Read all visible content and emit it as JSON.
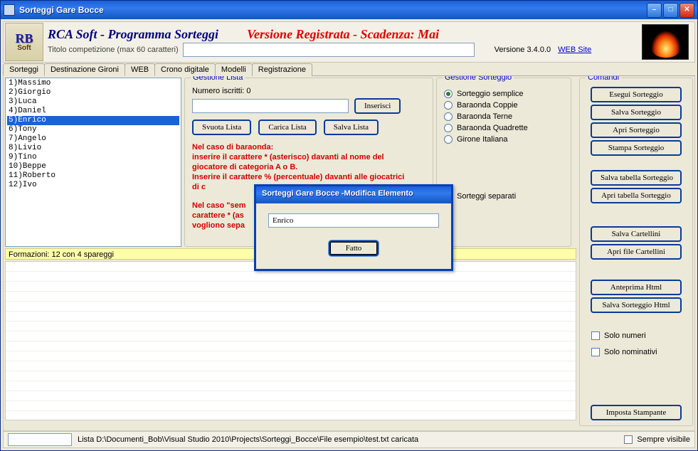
{
  "window": {
    "title": "Sorteggi Gare Bocce"
  },
  "header": {
    "app_title": "RCA Soft - Programma Sorteggi",
    "registered": "Versione Registrata - Scadenza: Mai",
    "comp_label": "Titolo competizione (max 60 caratteri)",
    "comp_value": "",
    "version_label": "Versione 3.4.0.0",
    "website_link": "WEB Site",
    "logo_top": "RB",
    "logo_bottom": "Soft"
  },
  "tabs": [
    "Sorteggi",
    "Destinazione Gironi",
    "WEB",
    "Crono digitale",
    "Modelli",
    "Registrazione"
  ],
  "list": [
    "1)Massimo",
    "2)Giorgio",
    "3)Luca",
    "4)Daniel",
    "5)Enrico",
    "6)Tony",
    "7)Angelo",
    "8)Livio",
    "9)Tino",
    "10)Beppe",
    "11)Roberto",
    "12)Ivo"
  ],
  "list_selected_index": 4,
  "gestione_lista": {
    "title": "Gestione Lista",
    "numero_label": "Numero iscritti: 0",
    "input_value": "",
    "btn_inserisci": "Inserisci",
    "btn_svuota": "Svuota Lista",
    "btn_carica": "Carica Lista",
    "btn_salva": "Salva Lista",
    "help1": "Nel caso di baraonda:\ninserire il carattere * (asterisco) davanti al nome del giocatore di categoria A o B.\nInserire il carattere % (percentuale) davanti alle giocatrici di c",
    "help2": "Nel caso \"sem\ncarattere * (as\nvogliono sepa"
  },
  "gestione_sorteggio": {
    "title": "Gestione Sorteggio",
    "options": [
      "Sorteggio semplice",
      "Baraonda Coppie",
      "Baraonda Terne",
      "Baraonda Quadrette",
      "Girone Italiana"
    ],
    "selected": 0,
    "check_label": "Sorteggi separati"
  },
  "comandi": {
    "title": "Comandi",
    "btns1": [
      "Esegui Sorteggio",
      "Salva Sorteggio",
      "Apri Sorteggio",
      "Stampa Sorteggio"
    ],
    "btns2": [
      "Salva tabella Sorteggio",
      "Apri tabella Sorteggio"
    ],
    "btns3": [
      "Salva Cartellini",
      "Apri file Cartellini"
    ],
    "btns4": [
      "Anteprima Html",
      "Salva Sorteggio Html"
    ],
    "check_numeri": "Solo numeri",
    "check_nominativi": "Solo nominativi",
    "btn_stampante": "Imposta Stampante"
  },
  "formazioni": "Formazioni: 12 con 4 spareggi",
  "statusbar": {
    "text": "Lista D:\\Documenti_Bob\\Visual Studio 2010\\Projects\\Sorteggi_Bocce\\File esempio\\test.txt caricata",
    "check_label": "Sempre visibile"
  },
  "dialog": {
    "title": "Sorteggi Gare Bocce -Modifica Elemento",
    "value": "Enrico",
    "btn_ok": "Fatto"
  }
}
